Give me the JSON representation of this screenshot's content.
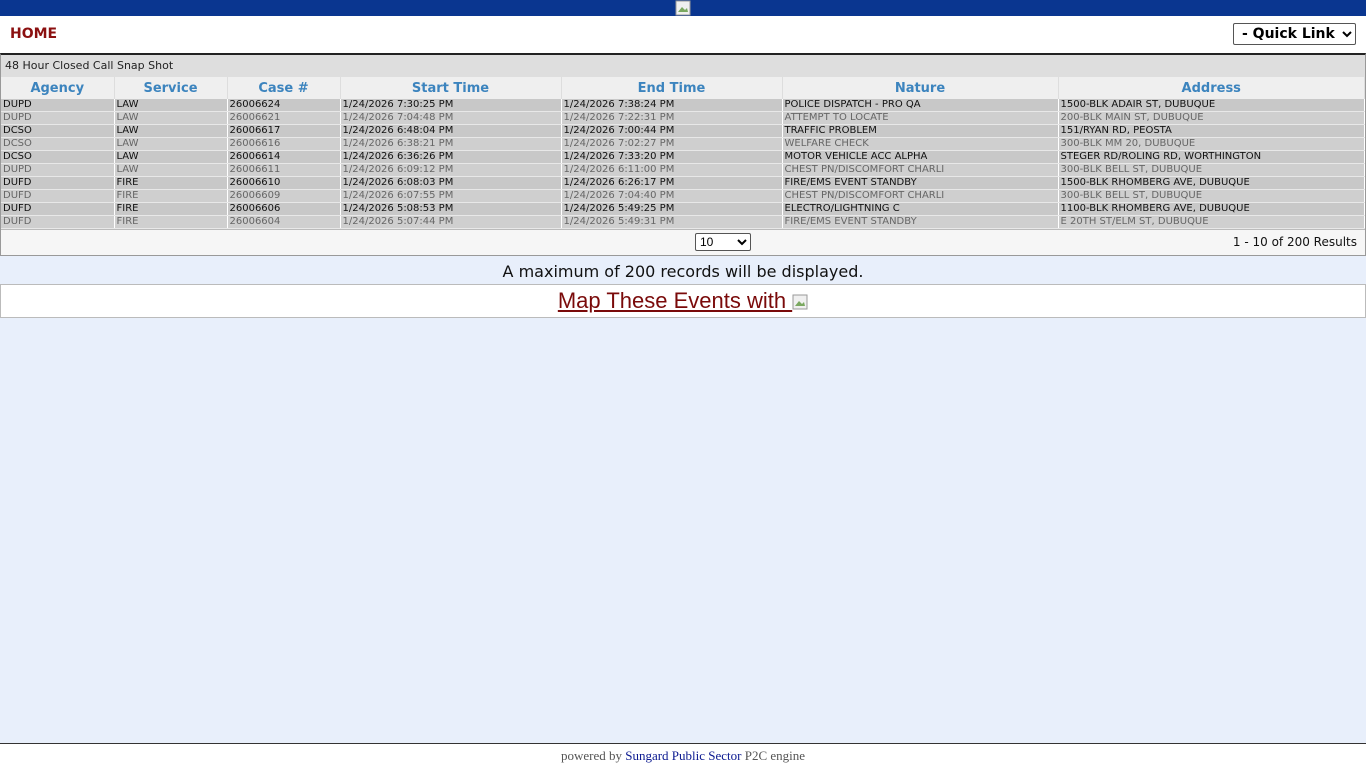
{
  "header": {
    "home_label": "HOME",
    "quick_links_selected": "- Quick Links -"
  },
  "grid": {
    "caption": "48 Hour Closed Call Snap Shot",
    "columns": [
      "Agency",
      "Service",
      "Case #",
      "Start Time",
      "End Time",
      "Nature",
      "Address"
    ],
    "rows": [
      [
        "DUPD",
        "LAW",
        "26006624",
        "1/24/2026 7:30:25 PM",
        "1/24/2026 7:38:24 PM",
        "POLICE DISPATCH - PRO QA",
        "1500-BLK ADAIR ST, DUBUQUE"
      ],
      [
        "DUPD",
        "LAW",
        "26006621",
        "1/24/2026 7:04:48 PM",
        "1/24/2026 7:22:31 PM",
        "ATTEMPT TO LOCATE",
        "200-BLK MAIN ST, DUBUQUE"
      ],
      [
        "DCSO",
        "LAW",
        "26006617",
        "1/24/2026 6:48:04 PM",
        "1/24/2026 7:00:44 PM",
        "TRAFFIC PROBLEM",
        "151/RYAN RD, PEOSTA"
      ],
      [
        "DCSO",
        "LAW",
        "26006616",
        "1/24/2026 6:38:21 PM",
        "1/24/2026 7:02:27 PM",
        "WELFARE CHECK",
        "300-BLK MM 20, DUBUQUE"
      ],
      [
        "DCSO",
        "LAW",
        "26006614",
        "1/24/2026 6:36:26 PM",
        "1/24/2026 7:33:20 PM",
        "MOTOR VEHICLE ACC ALPHA",
        "STEGER RD/ROLING RD, WORTHINGTON"
      ],
      [
        "DUPD",
        "LAW",
        "26006611",
        "1/24/2026 6:09:12 PM",
        "1/24/2026 6:11:00 PM",
        "CHEST PN/DISCOMFORT CHARLI",
        "300-BLK BELL ST, DUBUQUE"
      ],
      [
        "DUFD",
        "FIRE",
        "26006610",
        "1/24/2026 6:08:03 PM",
        "1/24/2026 6:26:17 PM",
        "FIRE/EMS EVENT STANDBY",
        "1500-BLK RHOMBERG AVE, DUBUQUE"
      ],
      [
        "DUFD",
        "FIRE",
        "26006609",
        "1/24/2026 6:07:55 PM",
        "1/24/2026 7:04:40 PM",
        "CHEST PN/DISCOMFORT CHARLI",
        "300-BLK BELL ST, DUBUQUE"
      ],
      [
        "DUFD",
        "FIRE",
        "26006606",
        "1/24/2026 5:08:53 PM",
        "1/24/2026 5:49:25 PM",
        "ELECTRO/LIGHTNING C",
        "1100-BLK RHOMBERG AVE, DUBUQUE"
      ],
      [
        "DUFD",
        "FIRE",
        "26006604",
        "1/24/2026 5:07:44 PM",
        "1/24/2026 5:49:31 PM",
        "FIRE/EMS EVENT STANDBY",
        "E 20TH ST/ELM ST, DUBUQUE"
      ]
    ],
    "page_size_selected": "10",
    "results_text": "1 - 10 of 200 Results"
  },
  "notes": {
    "max_records": "A maximum of 200 records will be displayed."
  },
  "map": {
    "link_text": "Map These Events with "
  },
  "footer": {
    "prefix": "powered by ",
    "vendor": "Sungard Public Sector",
    "suffix": " P2C engine"
  }
}
